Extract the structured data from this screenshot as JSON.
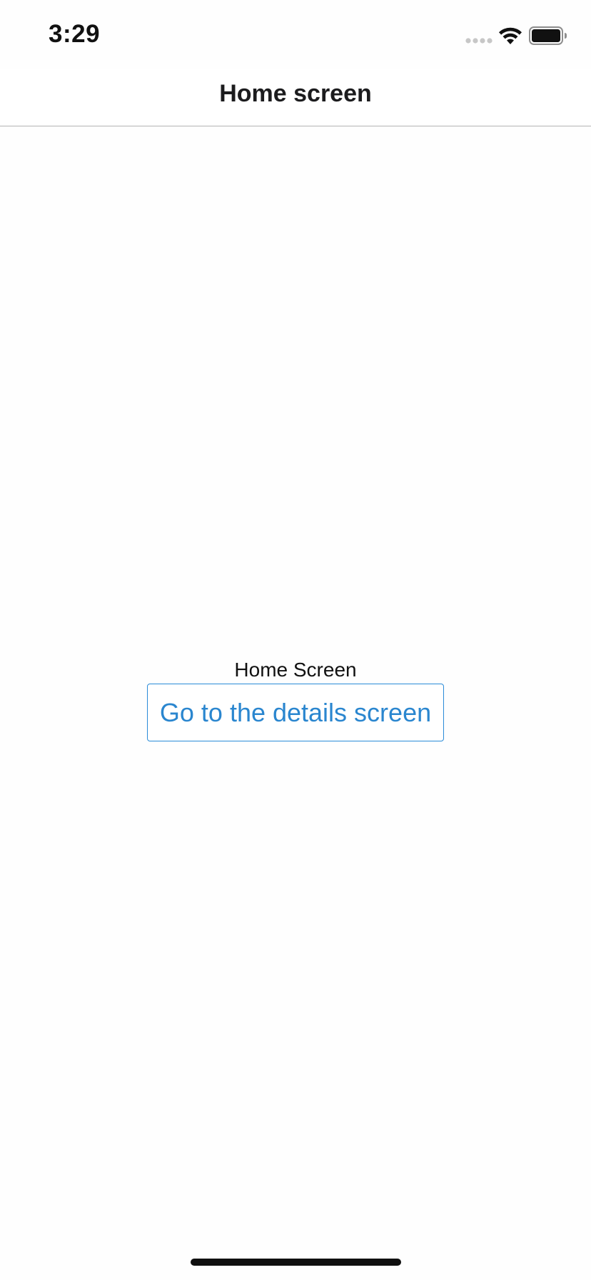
{
  "status_bar": {
    "time": "3:29",
    "signal_icon": "signal-dots-icon",
    "wifi_icon": "wifi-icon",
    "battery_icon": "battery-icon",
    "battery_level": 1.0
  },
  "nav": {
    "title": "Home screen"
  },
  "main": {
    "label": "Home Screen",
    "button_label": "Go to the details screen"
  },
  "colors": {
    "accent": "#2a86cf",
    "background": "#fefefe",
    "nav_divider": "#b3b3b3",
    "text": "#111111"
  }
}
